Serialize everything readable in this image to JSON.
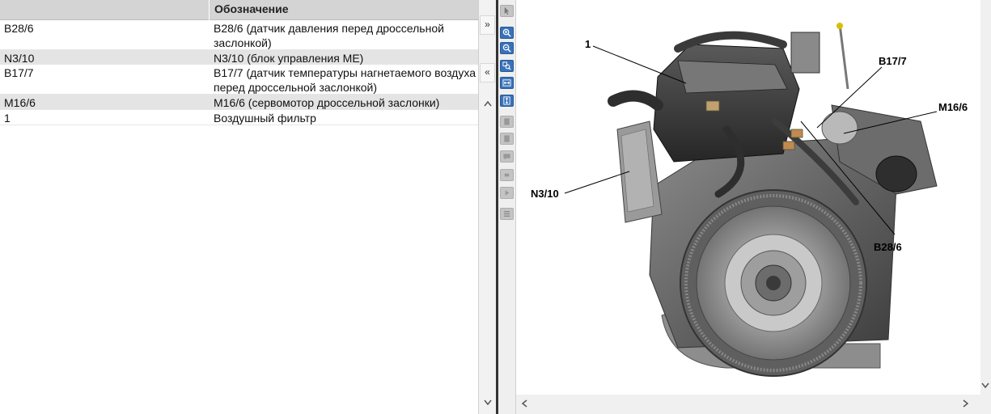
{
  "table": {
    "headers": [
      "",
      "Обозначение"
    ],
    "rows": [
      {
        "code": "B28/6",
        "desc": "B28/6 (датчик давления перед дроссельной заслонкой)",
        "shaded": false
      },
      {
        "code": "N3/10",
        "desc": "N3/10 (блок управления ME)",
        "shaded": true
      },
      {
        "code": "B17/7",
        "desc": "B17/7 (датчик температуры нагнетаемого воздуха перед дроссельной заслонкой)",
        "shaded": false
      },
      {
        "code": "M16/6",
        "desc": "M16/6 (сервомотор дроссельной заслонки)",
        "shaded": true
      },
      {
        "code": "1",
        "desc": "Воздушный фильтр",
        "shaded": false
      }
    ]
  },
  "splitter": {
    "expand_label": "»",
    "collapse_label": "«",
    "scroll_up": "^",
    "scroll_down": "v"
  },
  "toolbar": {
    "tools": [
      {
        "icon": "pointer-icon",
        "state": "disabled"
      },
      {
        "icon": "zoom-in-icon",
        "state": "active"
      },
      {
        "icon": "zoom-out-icon",
        "state": "active"
      },
      {
        "icon": "zoom-region-icon",
        "state": "active"
      },
      {
        "icon": "fit-width-icon",
        "state": "active"
      },
      {
        "icon": "fit-height-icon",
        "state": "active"
      },
      {
        "icon": "page-icon",
        "state": "disabled"
      },
      {
        "icon": "page-icon",
        "state": "disabled"
      },
      {
        "icon": "note-icon",
        "state": "disabled"
      },
      {
        "icon": "small-square-icon",
        "state": "disabled"
      },
      {
        "icon": "play-icon",
        "state": "disabled"
      },
      {
        "icon": "list-icon",
        "state": "disabled"
      }
    ]
  },
  "image": {
    "callouts": {
      "label_1": "1",
      "b17_7": "B17/7",
      "m16_6": "M16/6",
      "n3_10": "N3/10",
      "b28_6": "B28/6"
    }
  },
  "scroll": {
    "left": "<",
    "right": ">",
    "down": "v"
  },
  "colors": {
    "accent": "#3a72b8",
    "header_bg": "#d4d4d4",
    "shaded_row": "#e4e4e4",
    "divider": "#333333"
  }
}
